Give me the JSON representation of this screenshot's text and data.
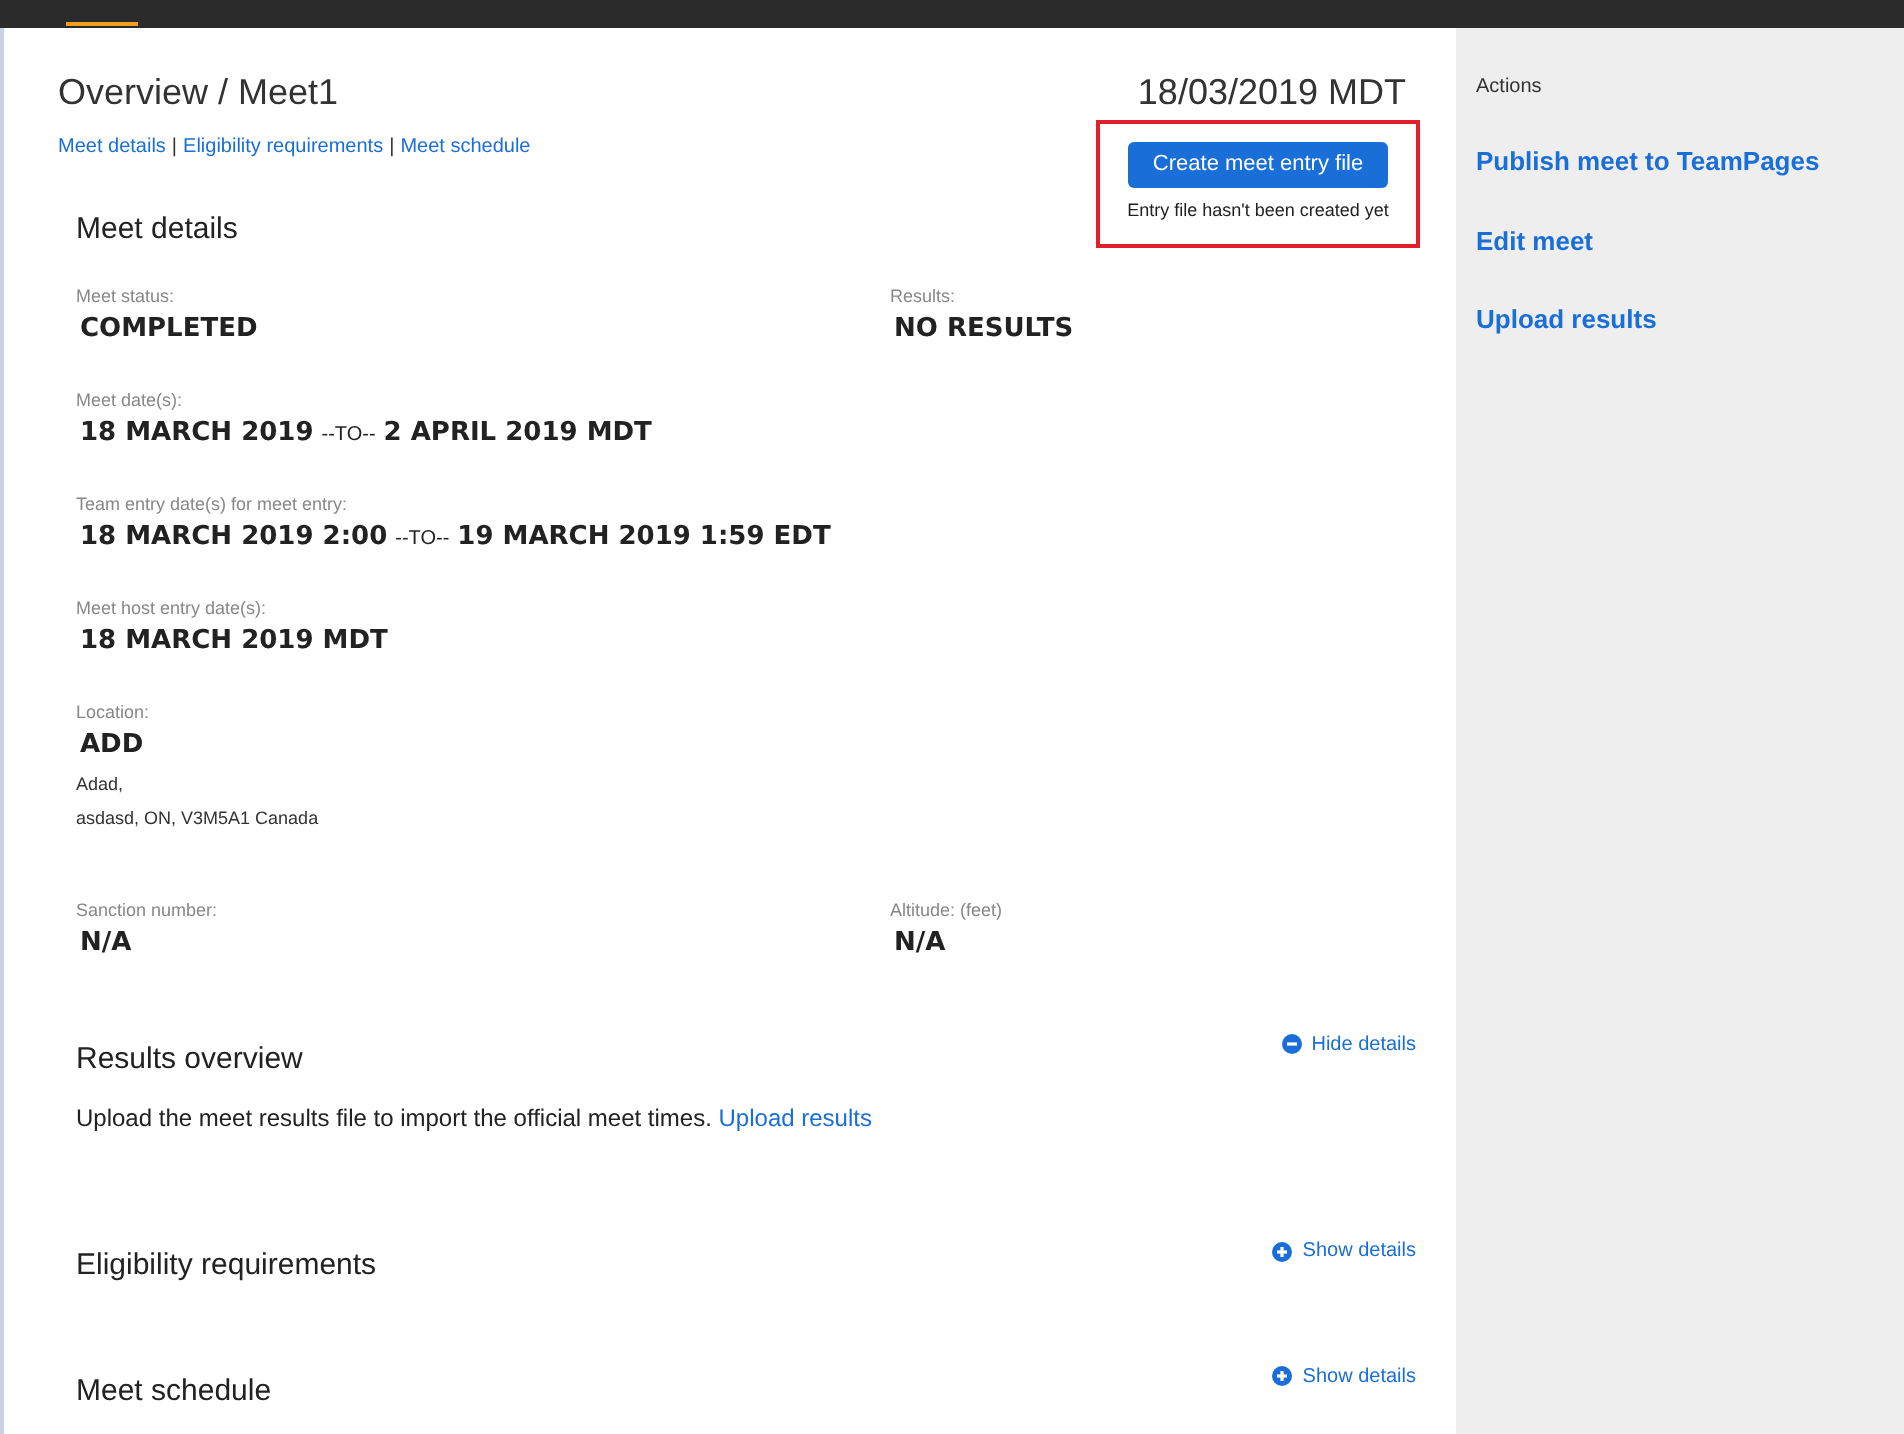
{
  "page": {
    "title": "Overview / Meet1",
    "date": "18/03/2019 MDT",
    "anchors": [
      "Meet details",
      "Eligibility requirements",
      "Meet schedule"
    ],
    "anchor_separator": "|"
  },
  "entry_file": {
    "button": "Create meet entry file",
    "note": "Entry file hasn't been created yet"
  },
  "meet_details": {
    "heading": "Meet details",
    "fields": [
      {
        "label": "Meet status:",
        "value": "COMPLETED"
      },
      {
        "label": "Results:",
        "value": "NO RESULTS"
      },
      {
        "label": "Meet date(s):",
        "from": "18 MARCH 2019",
        "separator": "--TO--",
        "to": "2 APRIL 2019 MDT"
      },
      {
        "label": "Team entry date(s) for meet entry:",
        "from": "18 MARCH 2019 2:00",
        "separator": "--TO--",
        "to": "19 MARCH 2019 1:59 EDT"
      },
      {
        "label": "Meet host entry date(s):",
        "value": "18 MARCH 2019 MDT"
      },
      {
        "label": "Location:",
        "value": "ADD",
        "lines": [
          "Adad,",
          "asdasd, ON, V3M5A1 Canada"
        ]
      },
      {
        "label": "Sanction number:",
        "value": "N/A"
      },
      {
        "label": "Altitude: (feet)",
        "value": "N/A"
      }
    ]
  },
  "sections": [
    {
      "heading": "Results overview",
      "toggle": "Hide details",
      "expanded": true,
      "text": "Upload the meet results file to import the official meet times.",
      "link": "Upload results"
    },
    {
      "heading": "Eligibility requirements",
      "toggle": "Show details",
      "expanded": false
    },
    {
      "heading": "Meet schedule",
      "toggle": "Show details",
      "expanded": false
    }
  ],
  "actions": {
    "title": "Actions",
    "items": [
      "Publish meet to TeamPages",
      "Edit meet",
      "Upload results"
    ]
  }
}
